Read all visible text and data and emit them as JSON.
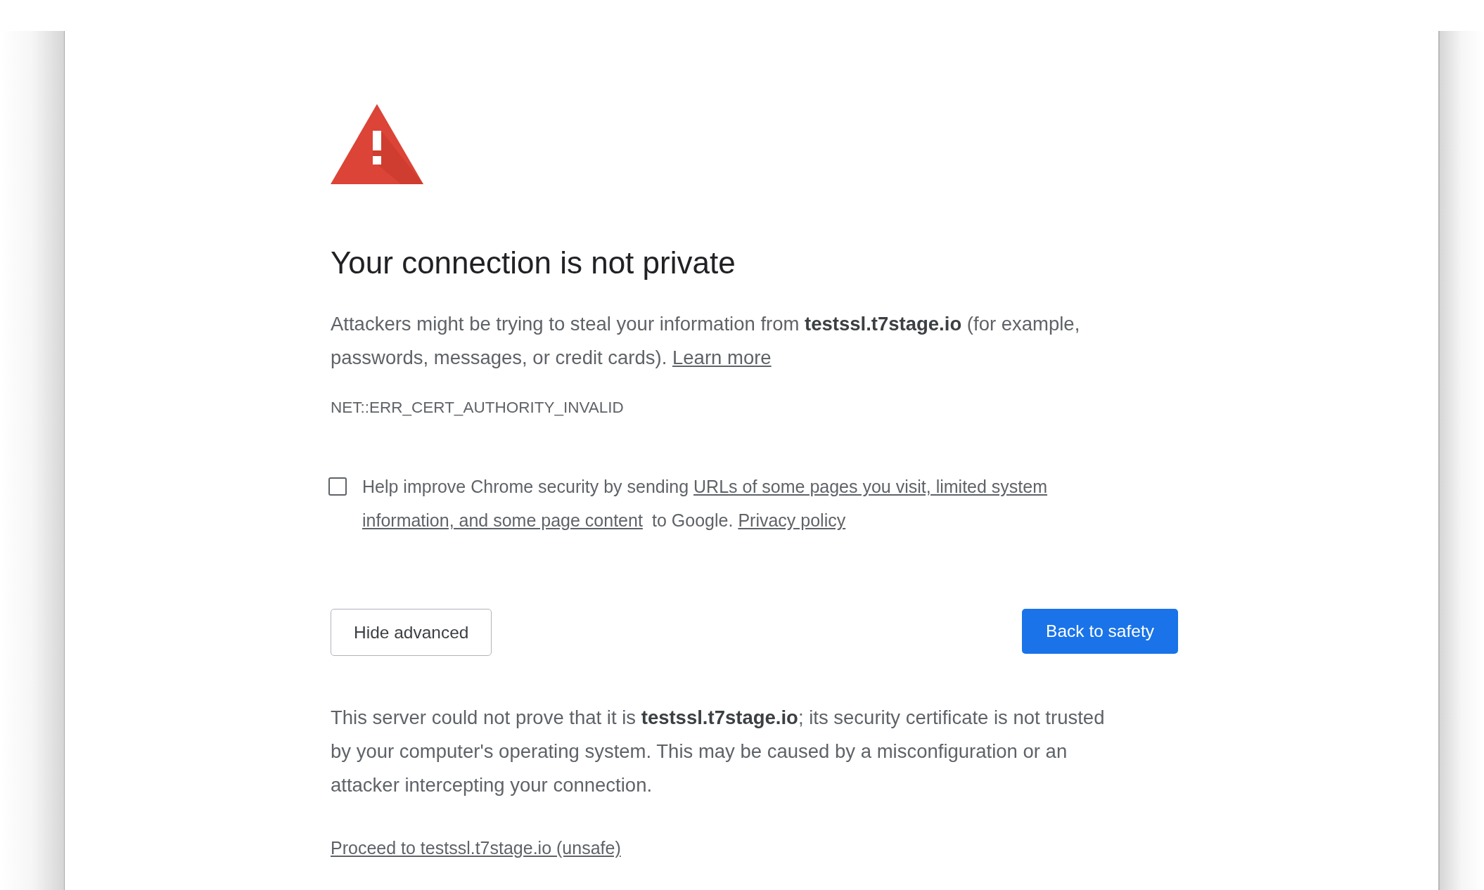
{
  "heading": "Your connection is not private",
  "description": [
    {
      "kind": "text",
      "text": "Attackers might be trying to steal your information from **testssl.t7stage.io** (for example, passwords, messages, or credit cards). "
    },
    {
      "kind": "link",
      "text": "Learn more"
    }
  ],
  "error_code": "NET::ERR_CERT_AUTHORITY_INVALID",
  "report_option": {
    "checked": false,
    "parts": [
      {
        "kind": "text",
        "text": "Help improve Chrome security by sending "
      },
      {
        "kind": "link",
        "text": "URLs of some pages you visit, limited system"
      },
      {
        "kind": "link",
        "text": "information, and some page content"
      },
      {
        "kind": "text",
        "text": " to Google. "
      },
      {
        "kind": "link",
        "text": "Privacy policy"
      }
    ]
  },
  "buttons": [
    {
      "kind": "secondary",
      "label": "Hide advanced"
    },
    {
      "kind": "primary",
      "label": "Back to safety"
    }
  ],
  "details": "This server could not prove that it is **testssl.t7stage.io**; its security certificate is not trusted by your computer's operating system. This may be caused by a misconfiguration or an attacker intercepting your connection.",
  "proceed_link": "Proceed to testssl.t7stage.io (unsafe)"
}
